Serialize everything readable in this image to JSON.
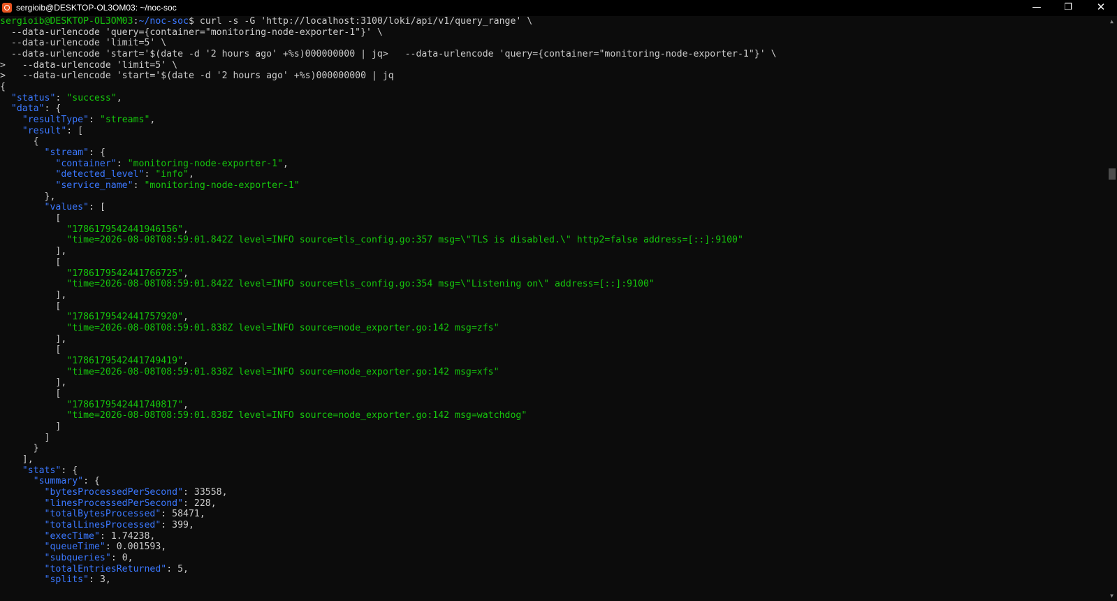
{
  "window": {
    "title": "sergioib@DESKTOP-OL3OM03: ~/noc-soc",
    "minimize_glyph": "—",
    "maximize_glyph": "❐",
    "close_glyph": "✕",
    "icon": "ubuntu-terminal-icon"
  },
  "colors": {
    "background": "#0c0c0c",
    "key": "#3b78ff",
    "string": "#16c60c",
    "text": "#cccccc"
  },
  "prompt": {
    "user_host": "sergioib@DESKTOP-OL3OM03",
    "sep": ":",
    "path": "~/noc-soc",
    "dollar": "$ ",
    "command_first": "curl -s -G 'http://localhost:3100/loki/api/v1/query_range' \\"
  },
  "command_lines": [
    "  --data-urlencode 'query={container=\"monitoring-node-exporter-1\"}' \\",
    "  --data-urlencode 'limit=5' \\",
    "  --data-urlencode 'start='$(date -d '2 hours ago' +%s)000000000 | jq>   --data-urlencode 'query={container=\"monitoring-node-exporter-1\"}' \\",
    ">   --data-urlencode 'limit=5' \\",
    ">   --data-urlencode 'start='$(date -d '2 hours ago' +%s)000000000 | jq"
  ],
  "json": {
    "open_brace": "{",
    "status_key": "\"status\"",
    "status_value": "\"success\"",
    "data_key": "\"data\"",
    "result_type_key": "\"resultType\"",
    "result_type_value": "\"streams\"",
    "result_key": "\"result\"",
    "stream_key": "\"stream\"",
    "container_key": "\"container\"",
    "container_value": "\"monitoring-node-exporter-1\"",
    "detected_level_key": "\"detected_level\"",
    "detected_level_value": "\"info\"",
    "service_name_key": "\"service_name\"",
    "service_name_value": "\"monitoring-node-exporter-1\"",
    "values_key": "\"values\"",
    "values": [
      {
        "ts": "\"1786179542441946156\"",
        "log": "\"time=2026-08-08T08:59:01.842Z level=INFO source=tls_config.go:357 msg=\\\"TLS is disabled.\\\" http2=false address=[::]:9100\""
      },
      {
        "ts": "\"1786179542441766725\"",
        "log": "\"time=2026-08-08T08:59:01.842Z level=INFO source=tls_config.go:354 msg=\\\"Listening on\\\" address=[::]:9100\""
      },
      {
        "ts": "\"1786179542441757920\"",
        "log": "\"time=2026-08-08T08:59:01.838Z level=INFO source=node_exporter.go:142 msg=zfs\""
      },
      {
        "ts": "\"1786179542441749419\"",
        "log": "\"time=2026-08-08T08:59:01.838Z level=INFO source=node_exporter.go:142 msg=xfs\""
      },
      {
        "ts": "\"1786179542441740817\"",
        "log": "\"time=2026-08-08T08:59:01.838Z level=INFO source=node_exporter.go:142 msg=watchdog\""
      }
    ],
    "stats_key": "\"stats\"",
    "summary_key": "\"summary\"",
    "summary": [
      {
        "key": "\"bytesProcessedPerSecond\"",
        "value": "33558"
      },
      {
        "key": "\"linesProcessedPerSecond\"",
        "value": "228"
      },
      {
        "key": "\"totalBytesProcessed\"",
        "value": "58471"
      },
      {
        "key": "\"totalLinesProcessed\"",
        "value": "399"
      },
      {
        "key": "\"execTime\"",
        "value": "1.74238"
      },
      {
        "key": "\"queueTime\"",
        "value": "0.001593"
      },
      {
        "key": "\"subqueries\"",
        "value": "0"
      },
      {
        "key": "\"totalEntriesReturned\"",
        "value": "5"
      },
      {
        "key": "\"splits\"",
        "value": "3"
      }
    ]
  },
  "scrollbar": {
    "up_glyph": "▲",
    "down_glyph": "▼"
  }
}
